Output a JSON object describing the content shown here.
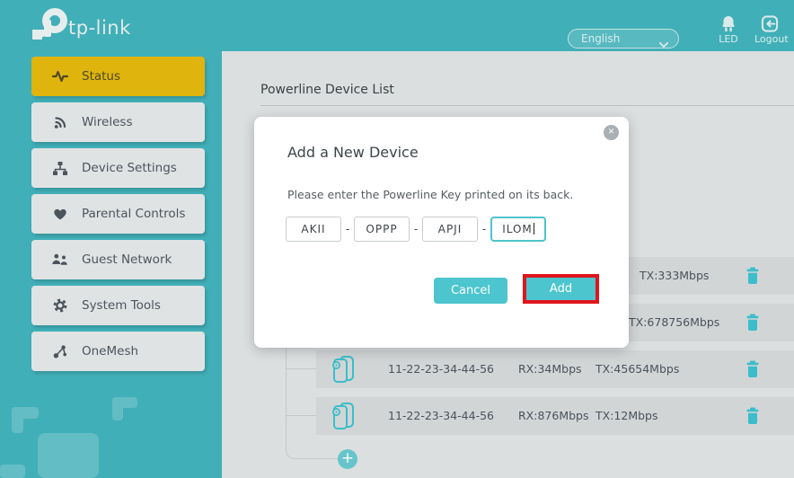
{
  "header": {
    "brand": "tp-link",
    "language_select": {
      "value": "English"
    },
    "led": {
      "label": "LED"
    },
    "logout": {
      "label": "Logout"
    }
  },
  "sidebar": {
    "items": [
      {
        "label": "Status"
      },
      {
        "label": "Wireless"
      },
      {
        "label": "Device Settings"
      },
      {
        "label": "Parental Controls"
      },
      {
        "label": "Guest Network"
      },
      {
        "label": "System Tools"
      },
      {
        "label": "OneMesh"
      }
    ]
  },
  "main": {
    "section_title": "Powerline Device List",
    "rows": [
      {
        "mac": "",
        "rx": "",
        "tx": "TX:333Mbps"
      },
      {
        "mac": "",
        "rx": "",
        "tx": "TX:678756Mbps"
      },
      {
        "mac": "11-22-23-34-44-56",
        "rx": "RX:34Mbps",
        "tx": "TX:45654Mbps"
      },
      {
        "mac": "11-22-23-34-44-56",
        "rx": "RX:876Mbps",
        "tx": "TX:12Mbps"
      }
    ],
    "add_device_button": "+"
  },
  "modal": {
    "title": "Add a New Device",
    "instruction": "Please enter the Powerline Key printed on its back.",
    "key_segments": [
      "AKII",
      "OPPP",
      "APJI",
      "ILOM"
    ],
    "segment_separator": "-",
    "cancel_label": "Cancel",
    "add_label": "Add",
    "close_label": "✕"
  },
  "colors": {
    "header_teal": "#41afb8",
    "active_gold": "#dfb40d",
    "button_teal": "#4cc5ce",
    "highlight_red": "#e0151d",
    "icon_teal": "#3bbdca"
  }
}
